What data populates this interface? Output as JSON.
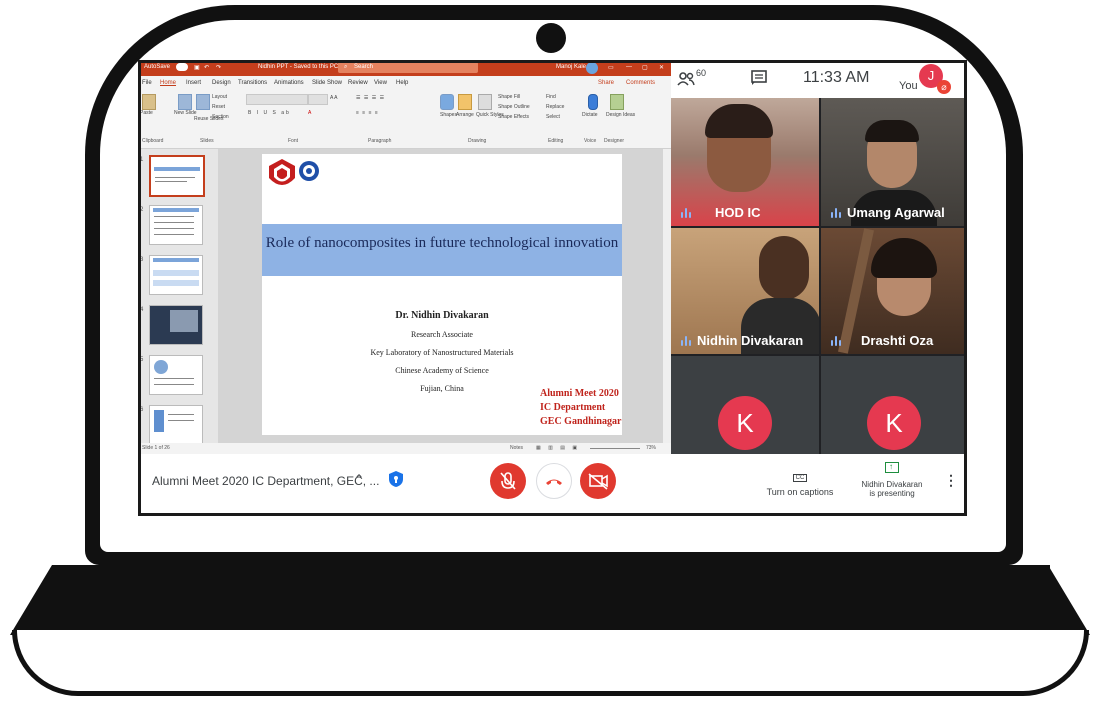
{
  "ppt": {
    "titlebar": {
      "autosave": "AutoSave",
      "doc_title": "Nidhin PPT - Saved to this PC",
      "search_placeholder": "Search",
      "user": "Manoj Kale"
    },
    "tabs": [
      "File",
      "Home",
      "Insert",
      "Design",
      "Transitions",
      "Animations",
      "Slide Show",
      "Review",
      "View",
      "Help"
    ],
    "share": "Share",
    "comments": "Comments",
    "ribbon_groups": [
      "Clipboard",
      "Slides",
      "Font",
      "Paragraph",
      "Drawing",
      "Editing",
      "Voice",
      "Designer"
    ],
    "ribbon_labels": {
      "paste": "Paste",
      "new_slide": "New Slide",
      "reuse_slides": "Reuse Slides",
      "layout": "Layout",
      "reset": "Reset",
      "section": "Section",
      "shapes": "Shapes",
      "arrange": "Arrange",
      "quick_styles": "Quick Styles",
      "shape_fill": "Shape Fill",
      "shape_outline": "Shape Outline",
      "shape_effects": "Shape Effects",
      "find": "Find",
      "replace": "Replace",
      "select": "Select",
      "dictate": "Dictate",
      "design_ideas": "Design Ideas"
    },
    "thumb_numbers": [
      "1",
      "2",
      "3",
      "4",
      "5",
      "6"
    ],
    "slide": {
      "title": "Role of nanocomposites in future technological innovation",
      "author": "Dr. Nidhin Divakaran",
      "role": "Research Associate",
      "lab": "Key Laboratory of Nanostructured Materials",
      "academy": "Chinese Academy of Science",
      "location": "Fujian, China",
      "event_line1": "Alumni Meet 2020",
      "event_line2": "IC Department",
      "event_line3": "GEC Gandhinagar"
    },
    "status": {
      "slide_count": "Slide 1 of 26",
      "notes": "Notes",
      "zoom": "73%"
    }
  },
  "meet": {
    "participants_count": "60",
    "time": "11:33 AM",
    "you_label": "You",
    "self_avatar_letter": "J",
    "tiles": [
      {
        "name": "HOD IC"
      },
      {
        "name": "Umang Agarwal"
      },
      {
        "name": "Nidhin Divakaran"
      },
      {
        "name": "Drashti Oza"
      },
      {
        "letter": "K"
      },
      {
        "letter": "K"
      }
    ],
    "meeting_title": "Alumni Meet 2020 IC Department, GEC, ...",
    "captions_label": "Turn on captions",
    "cc": "CC",
    "presenting_line1": "Nidhin Divakaran",
    "presenting_line2": "is presenting",
    "colors": {
      "end_call": "#e0392f",
      "avatar": "#e53950",
      "ppt_brand": "#c43e1c"
    }
  }
}
